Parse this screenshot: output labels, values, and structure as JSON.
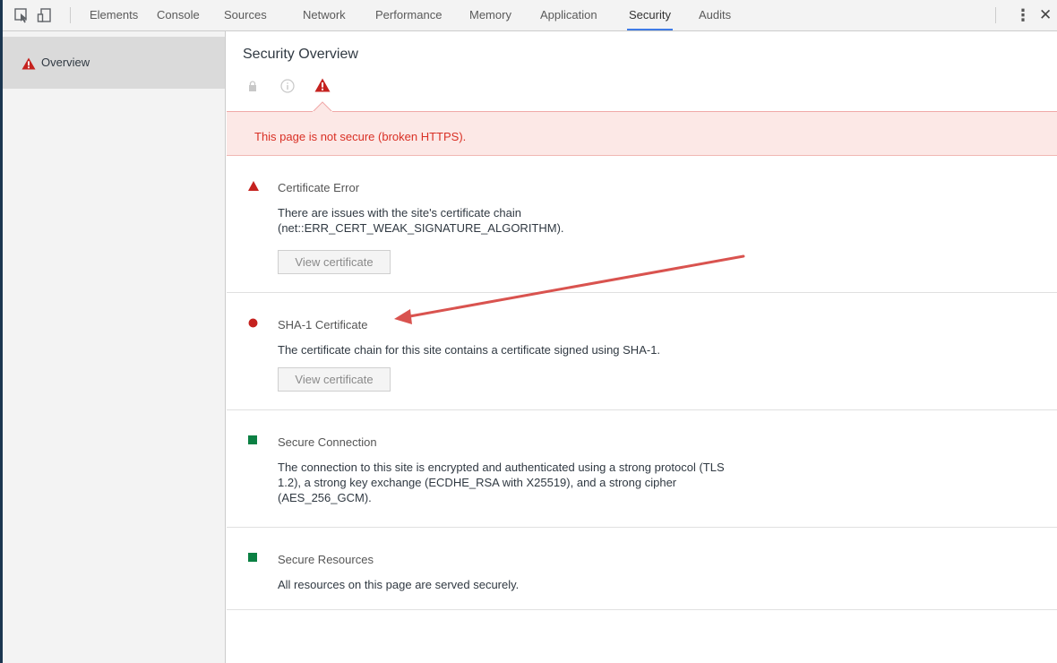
{
  "toolbar": {
    "tabs": [
      "Elements",
      "Console",
      "Sources",
      "Network",
      "Performance",
      "Memory",
      "Application",
      "Security",
      "Audits"
    ],
    "selected_tab": "Security",
    "accent_color": "#3f7be6"
  },
  "sidebar": {
    "items": [
      {
        "label": "Overview",
        "icon": "warning-icon"
      }
    ]
  },
  "main": {
    "title": "Security Overview",
    "banner": {
      "text": "This page is not secure (broken HTTPS).",
      "color": "#d93025"
    },
    "cards": [
      {
        "title": "Certificate Error",
        "description": "There are issues with the site's certificate chain (net::ERR_CERT_WEAK_SIGNATURE_ALGORITHM).",
        "button": "View certificate",
        "status_icon": "red-triangle-icon"
      },
      {
        "title": "SHA-1 Certificate",
        "description": "The certificate chain for this site contains a certificate signed using SHA-1.",
        "button": "View certificate",
        "status_icon": "red-circle-icon"
      },
      {
        "title": "Secure Connection",
        "description": "The connection to this site is encrypted and authenticated using a strong protocol (TLS 1.2), a strong key exchange (ECDHE_RSA with X25519), and a strong cipher (AES_256_GCM).",
        "status_icon": "green-square-icon"
      },
      {
        "title": "Secure Resources",
        "description": "All resources on this page are served securely.",
        "status_icon": "green-square-icon"
      }
    ]
  },
  "colors": {
    "danger": "#c5221f",
    "secure": "#0b8043"
  }
}
